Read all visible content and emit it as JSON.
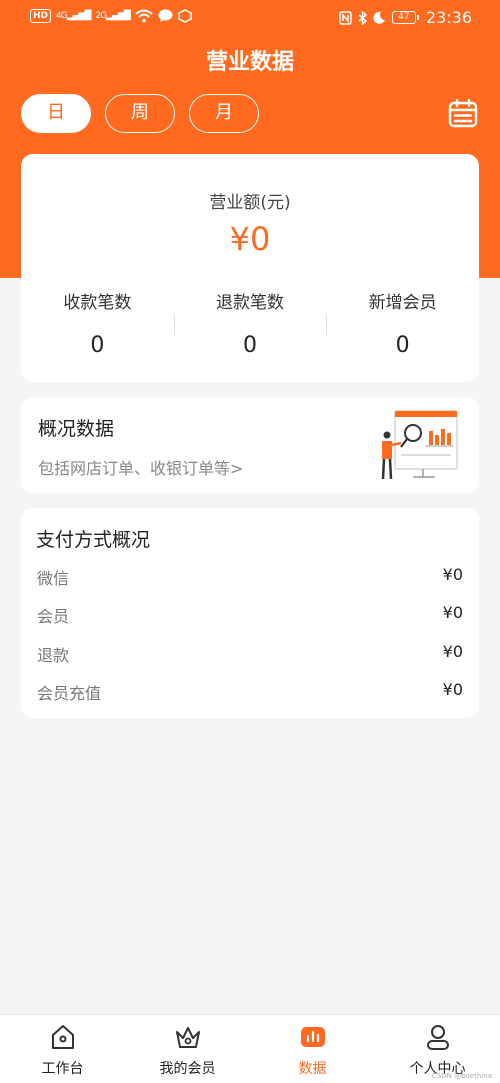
{
  "colors": {
    "accent": "#ff6a1f",
    "background": "#f5f5f5"
  },
  "status_bar": {
    "hd": "HD",
    "net1": "4G",
    "net2": "2G",
    "battery": "47",
    "time": "23:36"
  },
  "header": {
    "title": "营业数据"
  },
  "tabs": [
    {
      "label": "日",
      "active": true
    },
    {
      "label": "周",
      "active": false
    },
    {
      "label": "月",
      "active": false
    }
  ],
  "revenue": {
    "label": "营业额(元)",
    "value": "¥0",
    "stats": [
      {
        "label": "收款笔数",
        "value": "0"
      },
      {
        "label": "退款笔数",
        "value": "0"
      },
      {
        "label": "新增会员",
        "value": "0"
      }
    ]
  },
  "overview": {
    "title": "概况数据",
    "subtitle": "包括网店订单、收银订单等>"
  },
  "payment": {
    "title": "支付方式概况",
    "rows": [
      {
        "name": "微信",
        "value": "¥0"
      },
      {
        "name": "会员",
        "value": "¥0"
      },
      {
        "name": "退款",
        "value": "¥0"
      },
      {
        "name": "会员充值",
        "value": "¥0"
      }
    ]
  },
  "bottom_nav": [
    {
      "label": "工作台",
      "icon": "home-icon",
      "active": false
    },
    {
      "label": "我的会员",
      "icon": "crown-icon",
      "active": false
    },
    {
      "label": "数据",
      "icon": "chart-icon",
      "active": true
    },
    {
      "label": "个人中心",
      "icon": "user-icon",
      "active": false
    }
  ],
  "watermark": "CSDN @boethina"
}
